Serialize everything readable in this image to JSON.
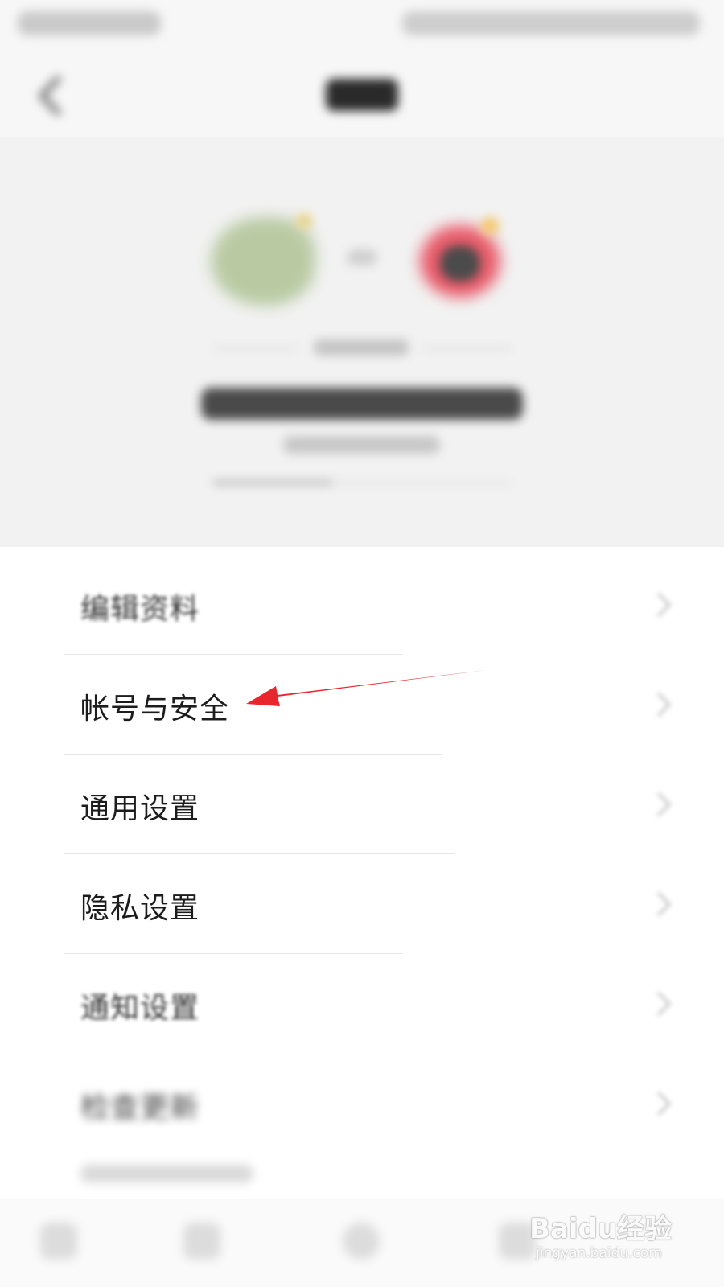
{
  "settings": {
    "items": [
      {
        "label": "编辑资料"
      },
      {
        "label": "帐号与安全"
      },
      {
        "label": "通用设置"
      },
      {
        "label": "隐私设置"
      },
      {
        "label": "通知设置"
      },
      {
        "label": "检查更新"
      }
    ]
  },
  "annotation": {
    "color": "#e8262b",
    "target": "帐号与安全"
  },
  "banner": {
    "progress_fraction": 0.4
  },
  "watermark": {
    "brand": "Baidu经验",
    "url": "jingyan.baidu.com"
  }
}
